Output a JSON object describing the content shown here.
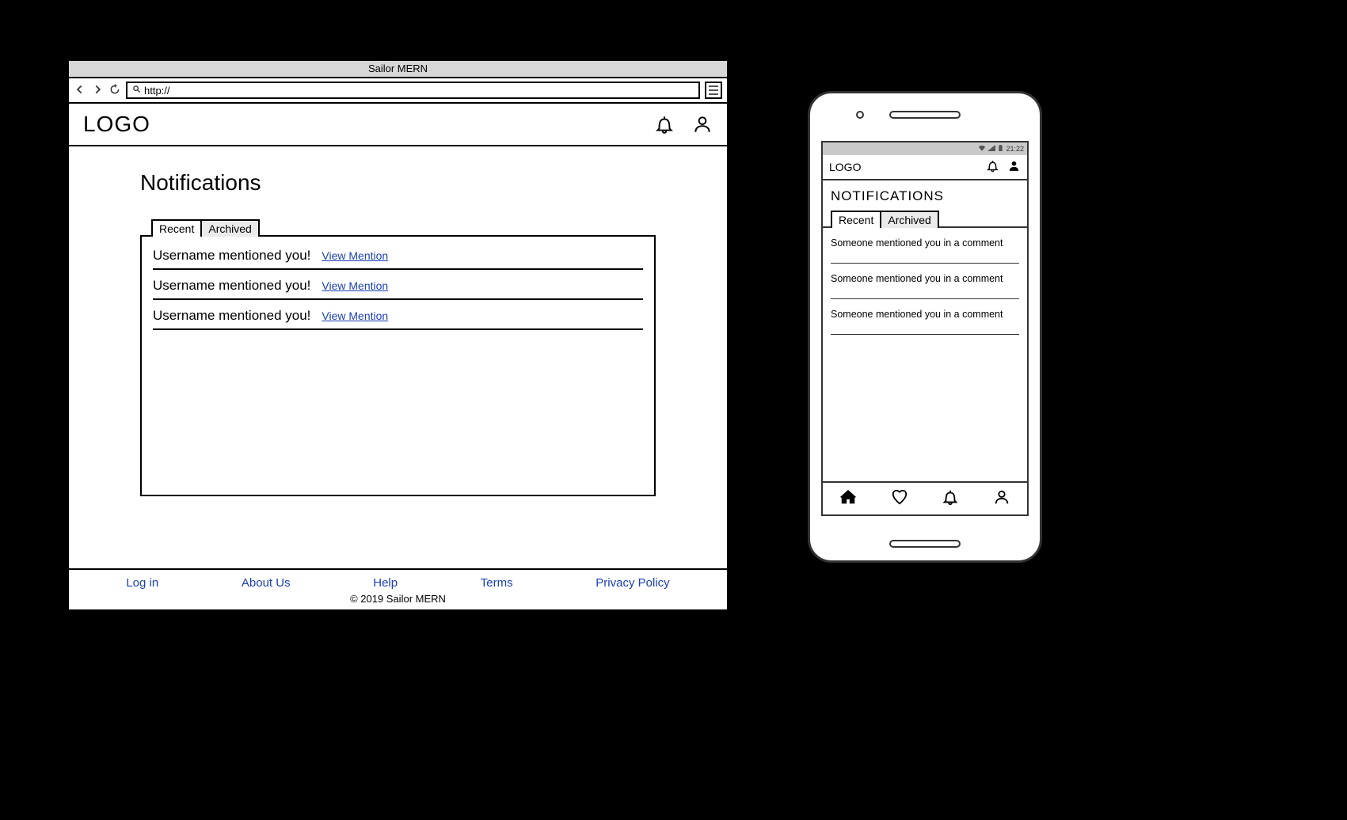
{
  "browser": {
    "title": "Sailor MERN",
    "url_prefix": "http://",
    "header": {
      "logo": "LOGO"
    },
    "page": {
      "title": "Notifications",
      "tabs": {
        "recent": "Recent",
        "archived": "Archived"
      },
      "notifications": [
        {
          "text": "Username mentioned you!",
          "link": "View Mention"
        },
        {
          "text": "Username mentioned you!",
          "link": "View Mention"
        },
        {
          "text": "Username mentioned you!",
          "link": "View Mention"
        }
      ]
    },
    "footer": {
      "links": {
        "login": "Log in",
        "about": "About Us",
        "help": "Help",
        "terms": "Terms",
        "privacy": "Privacy Policy"
      },
      "copyright": "© 2019 Sailor MERN"
    }
  },
  "mobile": {
    "status_time": "21:22",
    "header": {
      "logo": "LOGO"
    },
    "page": {
      "title": "NOTIFICATIONS",
      "tabs": {
        "recent": "Recent",
        "archived": "Archived"
      },
      "notifications": [
        {
          "text": "Someone mentioned you in a comment"
        },
        {
          "text": "Someone mentioned you in a comment"
        },
        {
          "text": "Someone mentioned you in a comment"
        }
      ]
    }
  }
}
